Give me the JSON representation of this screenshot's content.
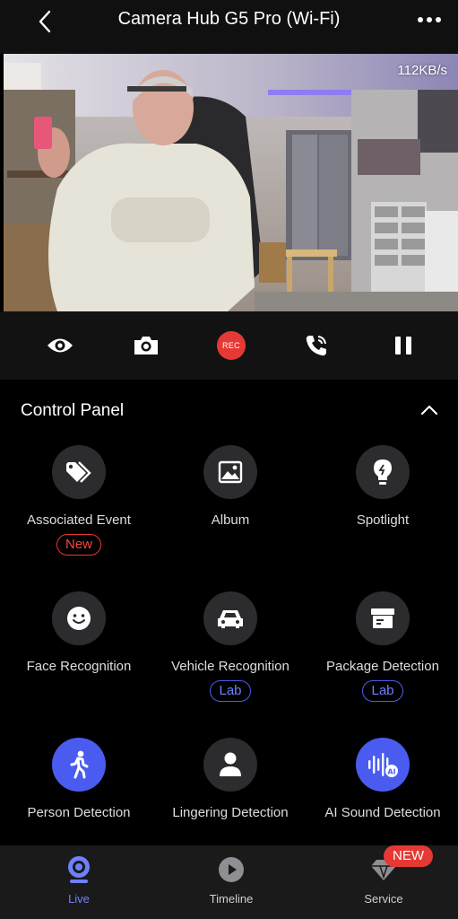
{
  "header": {
    "title": "Camera Hub G5 Pro (Wi-Fi)",
    "back_icon": "chevron-left-icon",
    "more_icon": "more-horizontal-icon"
  },
  "video": {
    "bitrate": "112KB/s"
  },
  "controls": {
    "view_icon": "eye-icon",
    "snapshot_icon": "camera-icon",
    "record_label": "REC",
    "call_icon": "phone-call-icon",
    "pause_icon": "pause-icon",
    "record_color": "#e53935"
  },
  "panel": {
    "title": "Control Panel",
    "collapse_icon": "chevron-up-icon",
    "items": [
      {
        "label": "Associated Event",
        "icon": "tags-icon",
        "badge": "New"
      },
      {
        "label": "Album",
        "icon": "image-icon"
      },
      {
        "label": "Spotlight",
        "icon": "bulb-icon"
      },
      {
        "label": "Face Recognition",
        "icon": "smile-icon"
      },
      {
        "label": "Vehicle Recognition",
        "icon": "car-icon",
        "badge": "Lab"
      },
      {
        "label": "Package Detection",
        "icon": "package-icon",
        "badge": "Lab"
      },
      {
        "label": "Person Detection",
        "icon": "walking-person-icon",
        "active": true
      },
      {
        "label": "Lingering Detection",
        "icon": "person-icon"
      },
      {
        "label": "AI Sound Detection",
        "icon": "sound-wave-ai-icon",
        "active": true
      }
    ]
  },
  "bottom_nav": {
    "items": [
      {
        "label": "Live",
        "icon": "live-camera-icon",
        "active": true
      },
      {
        "label": "Timeline",
        "icon": "play-circle-icon"
      },
      {
        "label": "Service",
        "icon": "diamond-icon"
      }
    ],
    "service_badge": "NEW"
  },
  "colors": {
    "accent": "#4a5cf0",
    "alert": "#e53935",
    "background": "#000000"
  }
}
